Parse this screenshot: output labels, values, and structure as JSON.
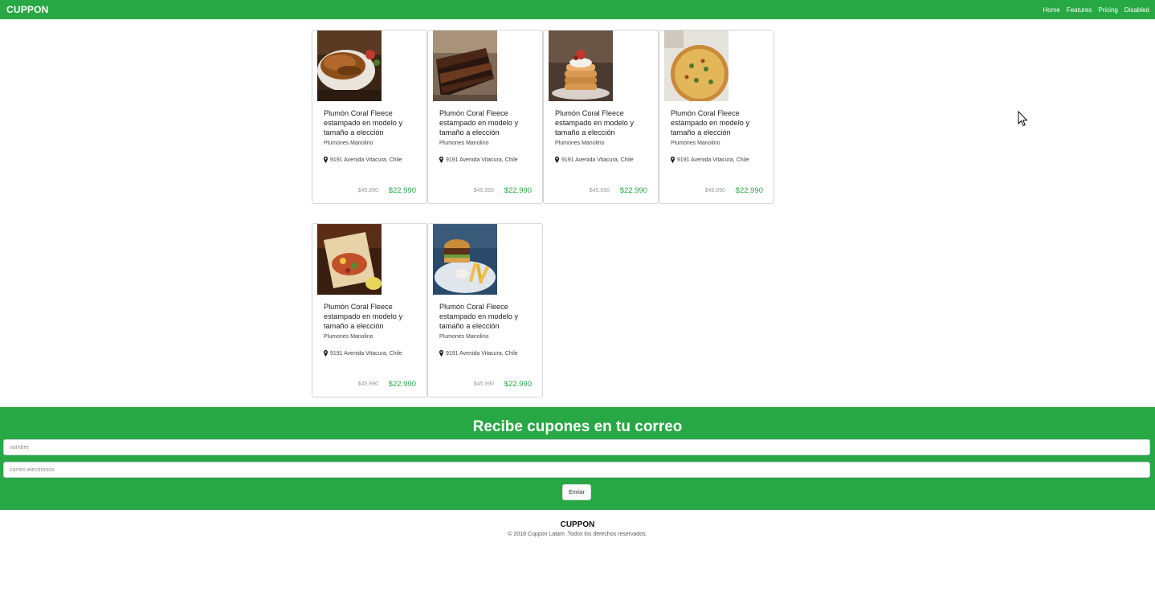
{
  "navbar": {
    "brand": "CUPPON",
    "links": [
      "Home",
      "Features",
      "Pricing",
      "Disabled"
    ]
  },
  "colors": {
    "brand_green": "#28a745",
    "price_green": "#28a745"
  },
  "cards": [
    {
      "image": "grilled-meat-photo",
      "title": "Plumón Coral Fleece estampado en modelo y tamaño a elección",
      "vendor": "Plumones Manolino",
      "location": "9191 Avenida Vitacura, Chile",
      "old_price": "$45.990",
      "price": "$22.990"
    },
    {
      "image": "chocolate-cake-photo",
      "title": "Plumón Coral Fleece estampado en modelo y tamaño a elección",
      "vendor": "Plumones Manolino",
      "location": "9191 Avenida Vitacura, Chile",
      "old_price": "$45.990",
      "price": "$22.990"
    },
    {
      "image": "pancake-stack-photo",
      "title": "Plumón Coral Fleece estampado en modelo y tamaño a elección",
      "vendor": "Plumones Manolino",
      "location": "9191 Avenida Vitacura, Chile",
      "old_price": "$45.990",
      "price": "$22.990"
    },
    {
      "image": "pizza-photo",
      "title": "Plumón Coral Fleece estampado en modelo y tamaño a elección",
      "vendor": "Plumones Manolino",
      "location": "9191 Avenida Vitacura, Chile",
      "old_price": "$45.990",
      "price": "$22.990"
    },
    {
      "image": "burrito-photo",
      "title": "Plumón Coral Fleece estampado en modelo y tamaño a elección",
      "vendor": "Plumones Manolino",
      "location": "9191 Avenida Vitacura, Chile",
      "old_price": "$45.990",
      "price": "$22.990"
    },
    {
      "image": "burger-fries-photo",
      "title": "Plumón Coral Fleece estampado en modelo y tamaño a elección",
      "vendor": "Plumones Manolino",
      "location": "9191 Avenida Vitacura, Chile",
      "old_price": "$45.990",
      "price": "$22.990"
    }
  ],
  "newsletter": {
    "title": "Recibe cupones en tu correo",
    "name_placeholder": "nombre",
    "email_placeholder": "correo electronico",
    "submit_label": "Enviar"
  },
  "footer": {
    "brand": "CUPPON",
    "copyright": "© 2018 Cuppon Latam .Todos los derechos reservados."
  }
}
